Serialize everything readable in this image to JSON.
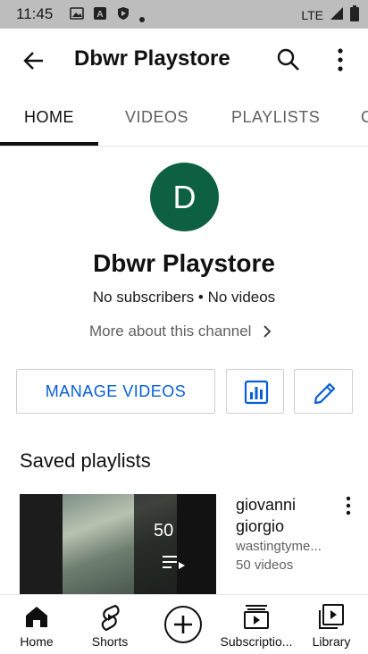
{
  "status_bar": {
    "time": "11:45",
    "network": "LTE"
  },
  "app_bar": {
    "title": "Dbwr Playstore"
  },
  "tabs": [
    {
      "label": "HOME",
      "active": true
    },
    {
      "label": "VIDEOS",
      "active": false
    },
    {
      "label": "PLAYLISTS",
      "active": false
    }
  ],
  "channel": {
    "avatar_letter": "D",
    "avatar_color": "#0d6142",
    "name": "Dbwr Playstore",
    "stats": "No subscribers • No videos",
    "more_about": "More about this channel"
  },
  "actions": {
    "manage_videos": "MANAGE VIDEOS"
  },
  "saved_playlists": {
    "title": "Saved playlists",
    "items": [
      {
        "title": "giovanni giorgio",
        "owner": "wastingtyme...",
        "videos": "50 videos",
        "count": "50"
      }
    ]
  },
  "bottom_nav": [
    {
      "label": "Home",
      "icon": "home-icon"
    },
    {
      "label": "Shorts",
      "icon": "shorts-icon"
    },
    {
      "label": "",
      "icon": "create-icon"
    },
    {
      "label": "Subscriptio...",
      "icon": "subscriptions-icon"
    },
    {
      "label": "Library",
      "icon": "library-icon"
    }
  ],
  "colors": {
    "accent_blue": "#065fd4",
    "text_secondary": "#606060"
  }
}
